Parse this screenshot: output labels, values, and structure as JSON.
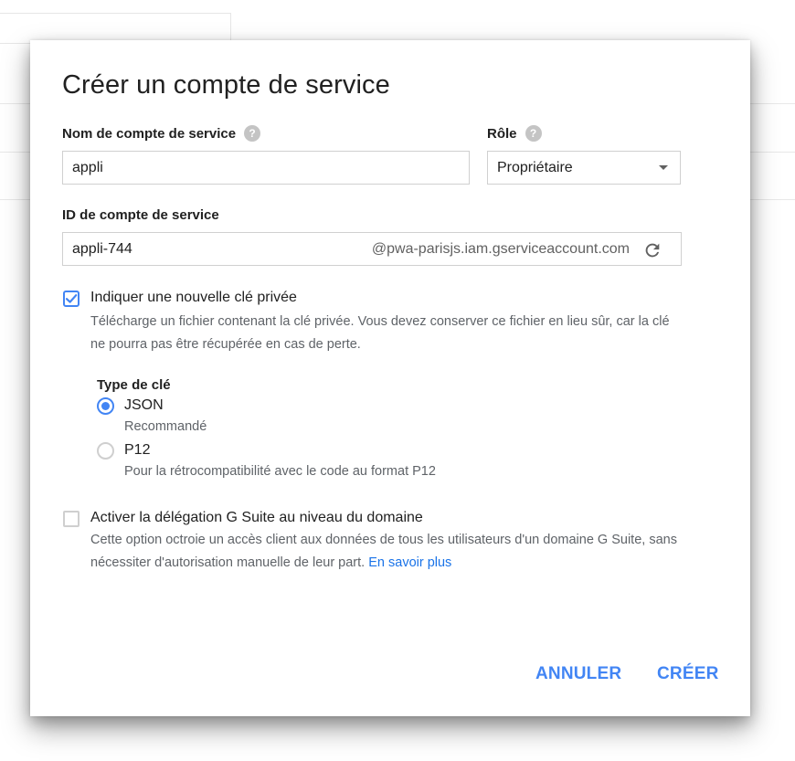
{
  "dialog": {
    "title": "Créer un compte de service",
    "name_field": {
      "label": "Nom de compte de service",
      "value": "appli"
    },
    "role_field": {
      "label": "Rôle",
      "selected": "Propriétaire"
    },
    "id_field": {
      "label": "ID de compte de service",
      "value": "appli-744",
      "suffix": "@pwa-parisjs.iam.gserviceaccount.com"
    },
    "private_key": {
      "checked": true,
      "label": "Indiquer une nouvelle clé privée",
      "description": "Télécharge un fichier contenant la clé privée. Vous devez conserver ce fichier en lieu sûr, car la clé ne pourra pas être récupérée en cas de perte.",
      "key_type_label": "Type de clé",
      "options": [
        {
          "label": "JSON",
          "description": "Recommandé",
          "selected": true
        },
        {
          "label": "P12",
          "description": "Pour la rétrocompatibilité avec le code au format P12",
          "selected": false
        }
      ]
    },
    "delegation": {
      "checked": false,
      "label": "Activer la délégation G Suite au niveau du domaine",
      "description": "Cette option octroie un accès client aux données de tous les utilisateurs d'un domaine G Suite, sans nécessiter d'autorisation manuelle de leur part.",
      "link": "En savoir plus"
    },
    "actions": {
      "cancel": "ANNULER",
      "create": "CRÉER"
    },
    "colors": {
      "accent": "#4285f4",
      "help_icon": "#c4c4c4"
    }
  }
}
